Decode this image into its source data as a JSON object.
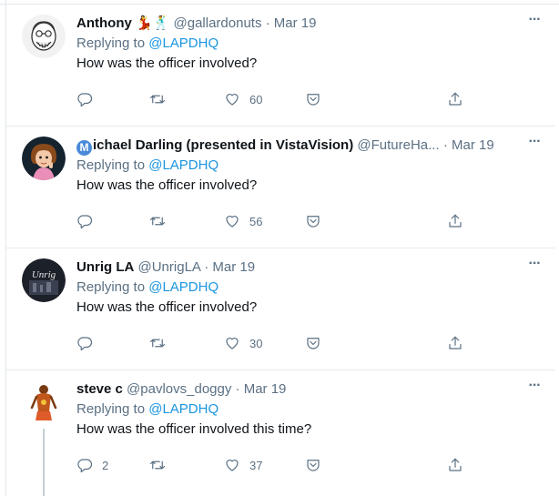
{
  "tweets": [
    {
      "name": "Anthony 💃🕺",
      "verified_badge": "",
      "handle": "@gallardonuts",
      "date": "· Mar 19",
      "replying_prefix": "Replying to",
      "replying_handle": "@LAPDHQ",
      "text": "How was the officer involved?",
      "replies": "",
      "likes": "60",
      "avatar": "cartoon-face-avatar"
    },
    {
      "name": "ichael Darling (presented in VistaVision)",
      "verified_badge": "M",
      "handle": "@FutureHa...",
      "date": "· Mar 19",
      "replying_prefix": "Replying to",
      "replying_handle": "@LAPDHQ",
      "text": "How was the officer involved?",
      "replies": "",
      "likes": "56",
      "avatar": "cartoon-girl-avatar"
    },
    {
      "name": "Unrig LA",
      "verified_badge": "",
      "handle": "@UnrigLA",
      "date": "· Mar 19",
      "replying_prefix": "Replying to",
      "replying_handle": "@LAPDHQ",
      "text": "How was the officer involved?",
      "replies": "",
      "likes": "30",
      "avatar": "unrig-logo-avatar",
      "avatar_text": "Unrig"
    },
    {
      "name": "steve c",
      "verified_badge": "",
      "handle": "@pavlovs_doggy",
      "date": "· Mar 19",
      "replying_prefix": "Replying to",
      "replying_handle": "@LAPDHQ",
      "text": "How was the officer involved this time?",
      "replies": "2",
      "likes": "37",
      "avatar": "figure-avatar"
    }
  ],
  "icons": {
    "more": "more-icon",
    "reply": "reply-icon",
    "retweet": "retweet-icon",
    "like": "heart-icon",
    "share": "share-icon",
    "upload": "upload-icon"
  },
  "colors": {
    "link": "#1b95e0",
    "secondary": "#5b7083",
    "text": "#0f1419",
    "border": "#e6ecf0"
  }
}
